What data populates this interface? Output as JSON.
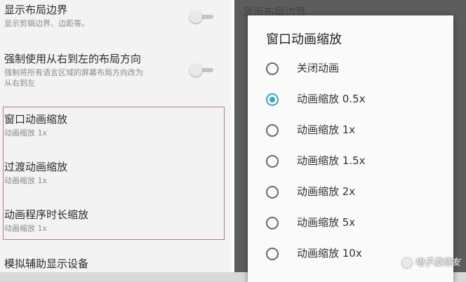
{
  "left": {
    "items": [
      {
        "title": "显示布局边界",
        "sub": "显示剪辑边界、边距等。",
        "toggle": false
      },
      {
        "title": "强制使用从右到左的布局方向",
        "sub1": "强制将所有语言区域的屏幕布局方向改为",
        "sub2": "从右到左",
        "toggle": false
      },
      {
        "title": "窗口动画缩放",
        "sub": "动画缩放 1x"
      },
      {
        "title": "过渡动画缩放",
        "sub": "动画缩放 1x"
      },
      {
        "title": "动画程序时长缩放",
        "sub": "动画缩放 1x"
      },
      {
        "title": "模拟辅助显示设备"
      }
    ]
  },
  "right_bg": {
    "row0": "显示布局边界"
  },
  "dialog": {
    "title": "窗口动画缩放",
    "options": [
      {
        "label": "关闭动画",
        "selected": false
      },
      {
        "label": "动画缩放 0.5x",
        "selected": true
      },
      {
        "label": "动画缩放 1x",
        "selected": false
      },
      {
        "label": "动画缩放 1.5x",
        "selected": false
      },
      {
        "label": "动画缩放 2x",
        "selected": false
      },
      {
        "label": "动画缩放 5x",
        "selected": false
      },
      {
        "label": "动画缩放 10x",
        "selected": false
      }
    ]
  },
  "watermark": "电子发烧友",
  "colors": {
    "accent": "#3aa6c6",
    "highlight_border": "#b47a7a"
  }
}
